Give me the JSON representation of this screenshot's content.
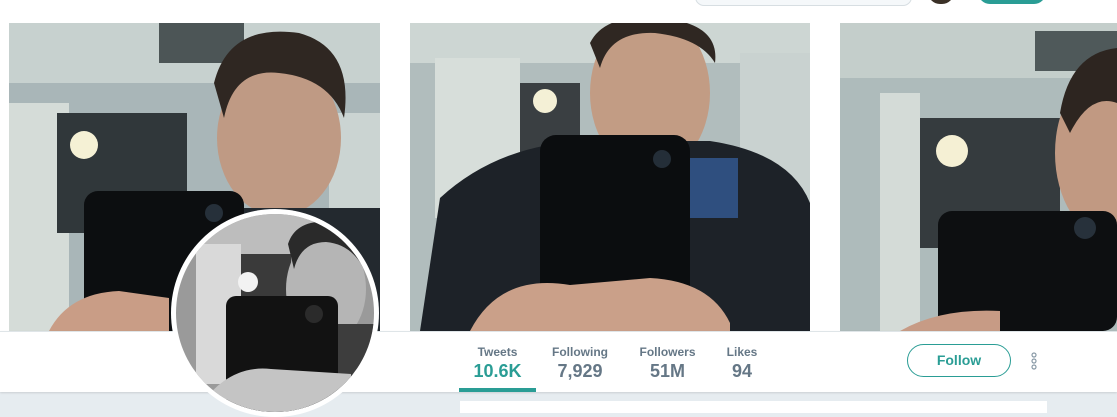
{
  "profile_nav": {
    "stats": [
      {
        "label": "Tweets",
        "value": "10.6K",
        "active": true
      },
      {
        "label": "Following",
        "value": "7,929",
        "active": false
      },
      {
        "label": "Followers",
        "value": "51M",
        "active": false
      },
      {
        "label": "Likes",
        "value": "94",
        "active": false
      }
    ],
    "follow_label": "Follow"
  },
  "colors": {
    "accent": "#2a9d95",
    "muted_text": "#657786",
    "page_background": "#e6ecf0"
  },
  "icons": {
    "more": "vertical-ellipsis"
  }
}
